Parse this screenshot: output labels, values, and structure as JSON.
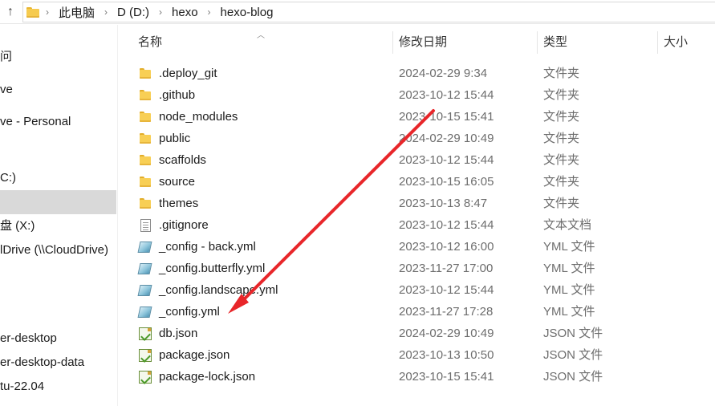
{
  "address_bar": {
    "crumbs": [
      "此电脑",
      "D (D:)",
      "hexo",
      "hexo-blog"
    ]
  },
  "nav": {
    "items": [
      {
        "label": "问"
      },
      {
        "label": "ve"
      },
      {
        "label": "ve - Personal"
      },
      {
        "label": "C:)"
      },
      {
        "label": ""
      },
      {
        "label": "盘 (X:)"
      },
      {
        "label": "lDrive (\\\\CloudDrive)"
      },
      {
        "label": "er-desktop"
      },
      {
        "label": "er-desktop-data"
      },
      {
        "label": "tu-22.04"
      }
    ]
  },
  "columns": {
    "name": "名称",
    "date": "修改日期",
    "type": "类型",
    "size": "大小"
  },
  "files": [
    {
      "name": ".deploy_git",
      "date": "2024-02-29 9:34",
      "type": "文件夹",
      "icon": "folder-icon"
    },
    {
      "name": ".github",
      "date": "2023-10-12 15:44",
      "type": "文件夹",
      "icon": "folder-icon"
    },
    {
      "name": "node_modules",
      "date": "2023-10-15 15:41",
      "type": "文件夹",
      "icon": "folder-icon"
    },
    {
      "name": "public",
      "date": "2024-02-29 10:49",
      "type": "文件夹",
      "icon": "folder-icon"
    },
    {
      "name": "scaffolds",
      "date": "2023-10-12 15:44",
      "type": "文件夹",
      "icon": "folder-icon"
    },
    {
      "name": "source",
      "date": "2023-10-15 16:05",
      "type": "文件夹",
      "icon": "folder-icon"
    },
    {
      "name": "themes",
      "date": "2023-10-13 8:47",
      "type": "文件夹",
      "icon": "folder-icon"
    },
    {
      "name": ".gitignore",
      "date": "2023-10-12 15:44",
      "type": "文本文档",
      "icon": "text-file-icon"
    },
    {
      "name": "_config - back.yml",
      "date": "2023-10-12 16:00",
      "type": "YML 文件",
      "icon": "yml-file-icon"
    },
    {
      "name": "_config.butterfly.yml",
      "date": "2023-11-27 17:00",
      "type": "YML 文件",
      "icon": "yml-file-icon"
    },
    {
      "name": "_config.landscape.yml",
      "date": "2023-10-12 15:44",
      "type": "YML 文件",
      "icon": "yml-file-icon"
    },
    {
      "name": "_config.yml",
      "date": "2023-11-27 17:28",
      "type": "YML 文件",
      "icon": "yml-file-icon"
    },
    {
      "name": "db.json",
      "date": "2024-02-29 10:49",
      "type": "JSON 文件",
      "icon": "json-file-icon"
    },
    {
      "name": "package.json",
      "date": "2023-10-13 10:50",
      "type": "JSON 文件",
      "icon": "json-file-icon"
    },
    {
      "name": "package-lock.json",
      "date": "2023-10-15 15:41",
      "type": "JSON 文件",
      "icon": "json-file-icon"
    }
  ],
  "annotation": {
    "color": "#e8262a"
  }
}
